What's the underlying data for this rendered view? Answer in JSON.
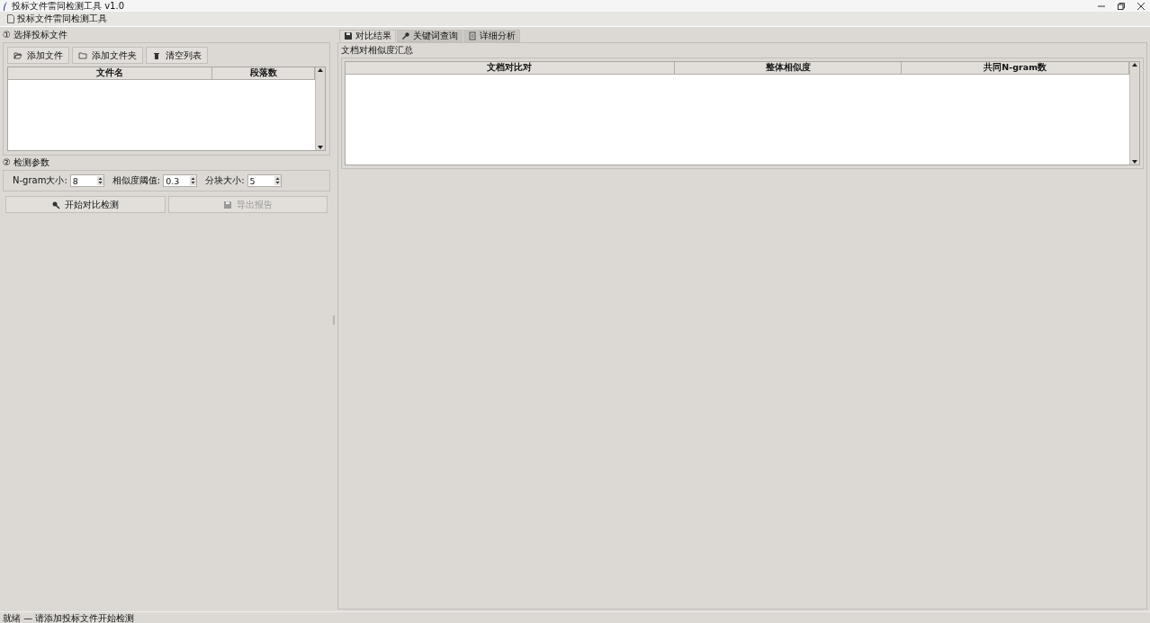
{
  "window": {
    "title": "投标文件雷同检测工具 v1.0"
  },
  "menu": {
    "label": "投标文件雷同检测工具"
  },
  "file_section": {
    "title": "① 选择投标文件",
    "buttons": [
      {
        "label": "添加文件",
        "kind": "folder-open"
      },
      {
        "label": "添加文件夹",
        "kind": "folder"
      },
      {
        "label": "清空列表",
        "kind": "trash"
      }
    ],
    "table": {
      "columns": [
        "文件名",
        "段落数"
      ]
    }
  },
  "params_section": {
    "title": "② 检测参数",
    "fields": [
      {
        "label": "N-gram大小:",
        "value": "8"
      },
      {
        "label": "相似度阈值:",
        "value": "0.3"
      },
      {
        "label": "分块大小:",
        "value": "5"
      }
    ]
  },
  "actions": [
    {
      "label": "开始对比检测",
      "kind": "search",
      "disabled": false
    },
    {
      "label": "导出报告",
      "kind": "save",
      "disabled": true
    }
  ],
  "tabs": [
    {
      "label": "对比结果",
      "kind": "save",
      "selected": true
    },
    {
      "label": "关键词查询",
      "kind": "key",
      "selected": false
    },
    {
      "label": "详细分析",
      "kind": "doc",
      "selected": false
    }
  ],
  "results": {
    "title": "文档对相似度汇总",
    "columns": [
      "文档对比对",
      "整体相似度",
      "共同N-gram数"
    ]
  },
  "status_bar": "就绪 — 请添加投标文件开始检测"
}
